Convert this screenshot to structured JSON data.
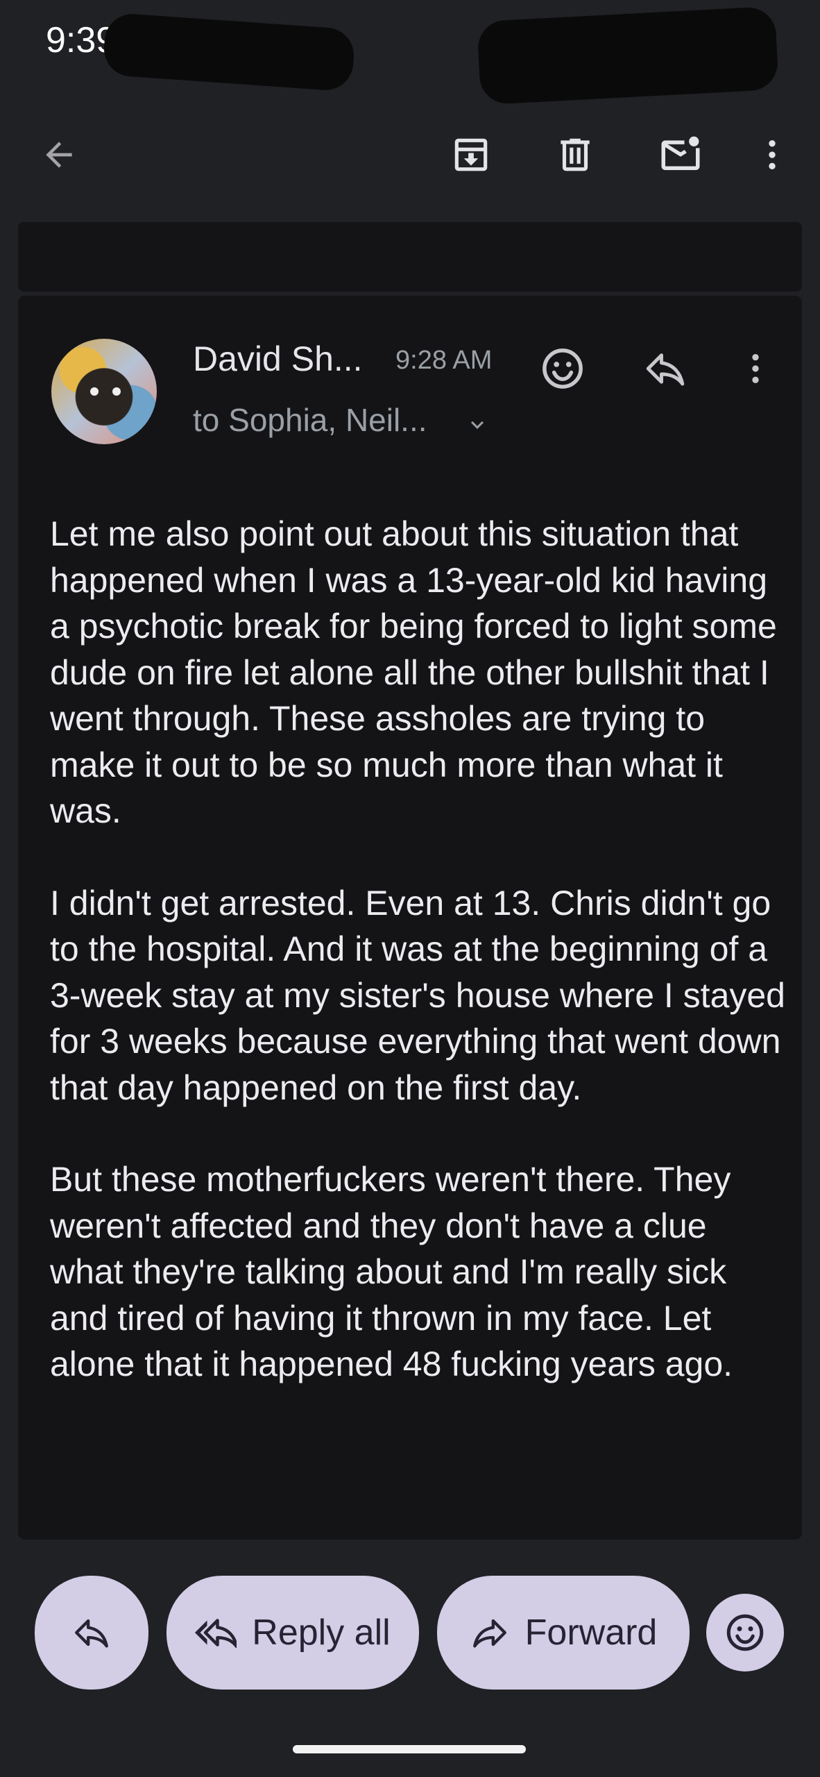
{
  "status_bar": {
    "time": "9:39"
  },
  "toolbar": {
    "back_icon": "arrow-back-icon",
    "archive_icon": "archive-icon",
    "delete_icon": "trash-icon",
    "mark_unread_icon": "mail-unread-icon",
    "more_icon": "more-vert-icon"
  },
  "email": {
    "sender": "David Sh...",
    "time": "9:28 AM",
    "recipients": "to Sophia, Neil...",
    "body": [
      "Let me also point out about this situation that happened when I was a 13-year-old kid having a psychotic break for being forced to light some dude on fire let alone all the other bullshit that I went through. These assholes are trying to make it out to be so much more than what it was.",
      "I didn't get arrested. Even at 13. Chris didn't go to the hospital. And it was at the beginning of a 3-week stay at my sister's house where I stayed for 3 weeks because everything that went down that day happened on the first day.",
      "But these motherfuckers weren't there. They weren't affected and they don't have a clue what they're talking about and I'm really sick and tired of having it thrown in my face. Let alone that it happened 48 fucking years ago."
    ]
  },
  "actions": {
    "reply_all": "Reply all",
    "forward": "Forward"
  },
  "colors": {
    "background": "#202125",
    "card": "#141417",
    "action_button": "#d3cde6"
  }
}
